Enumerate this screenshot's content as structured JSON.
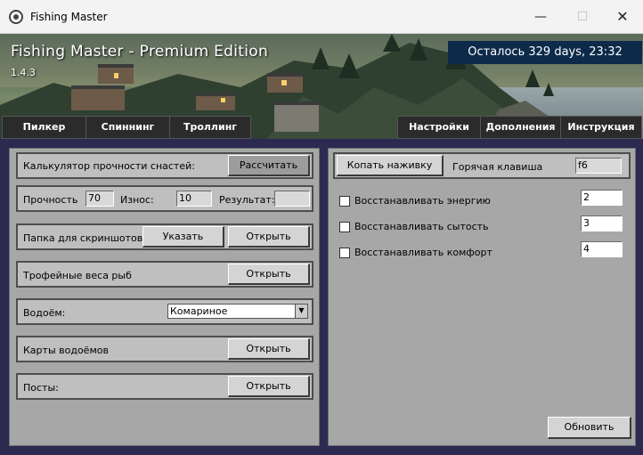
{
  "window": {
    "title": "Fishing Master",
    "min_glyph": "—",
    "max_glyph": "☐",
    "close_glyph": "✕"
  },
  "banner": {
    "title": "Fishing Master - Premium Edition",
    "version": "1.4.3",
    "countdown": "Осталось 329 days, 23:32"
  },
  "tabs_left": [
    {
      "label": "Пилкер"
    },
    {
      "label": "Спиннинг"
    },
    {
      "label": "Троллинг"
    }
  ],
  "tabs_right": [
    {
      "label": "Настройки"
    },
    {
      "label": "Дополнения"
    },
    {
      "label": "Инструкция"
    }
  ],
  "left": {
    "calc_label": "Калькулятор прочности снастей:",
    "calc_button": "Рассчитать",
    "strength_label": "Прочность",
    "strength_value": "70",
    "wear_label": "Износ:",
    "wear_value": "10",
    "result_label": "Результат:",
    "result_value": "",
    "screens_label": "Папка для скриншотов:",
    "specify_button": "Указать",
    "open_button": "Открыть",
    "trophy_label": "Трофейные веса рыб",
    "water_label": "Водоём:",
    "water_selected": "Комариное",
    "maps_label": "Карты водоёмов",
    "posts_label": "Посты:"
  },
  "right": {
    "dig_button": "Копать наживку",
    "hotkey_label": "Горячая клавиша",
    "hotkey_value": "f6",
    "opt_energy": "Восстанавливать энергию",
    "opt_energy_value": "2",
    "opt_satiety": "Восстанавливать сытость",
    "opt_satiety_value": "3",
    "opt_comfort": "Восстанавливать комфорт",
    "opt_comfort_value": "4",
    "update_button": "Обновить"
  },
  "icons": {
    "app": "fishing-master-logo-icon",
    "dropdown": "chevron-down-icon"
  }
}
